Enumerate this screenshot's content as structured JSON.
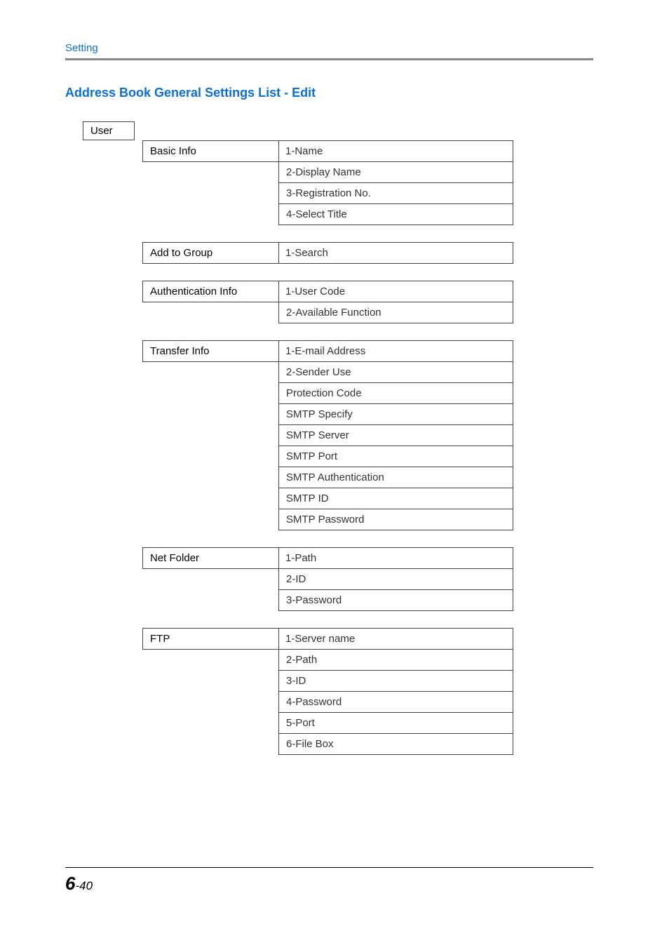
{
  "header": {
    "label": "Setting"
  },
  "title": "Address Book General Settings List - Edit",
  "root_box": "User",
  "sections": [
    {
      "header": "Basic Info",
      "items": [
        "1-Name",
        "2-Display Name",
        "3-Registration No.",
        "4-Select Title"
      ]
    },
    {
      "header": "Add to Group",
      "items": [
        "1-Search"
      ]
    },
    {
      "header": "Authentication Info",
      "items": [
        "1-User Code",
        "2-Available Function"
      ]
    },
    {
      "header": "Transfer Info",
      "items": [
        "1-E-mail Address",
        "2-Sender Use",
        "Protection Code",
        "SMTP Specify",
        "SMTP Server",
        "SMTP Port",
        "SMTP Authentication",
        "SMTP ID",
        "SMTP Password"
      ]
    },
    {
      "header": "Net Folder",
      "items": [
        "1-Path",
        "2-ID",
        "3-Password"
      ]
    },
    {
      "header": "FTP",
      "items": [
        "1-Server name",
        "2-Path",
        "3-ID",
        "4-Password",
        "5-Port",
        "6-File Box"
      ]
    }
  ],
  "page_number": {
    "chapter": "6",
    "sep": "-",
    "page": "40"
  }
}
